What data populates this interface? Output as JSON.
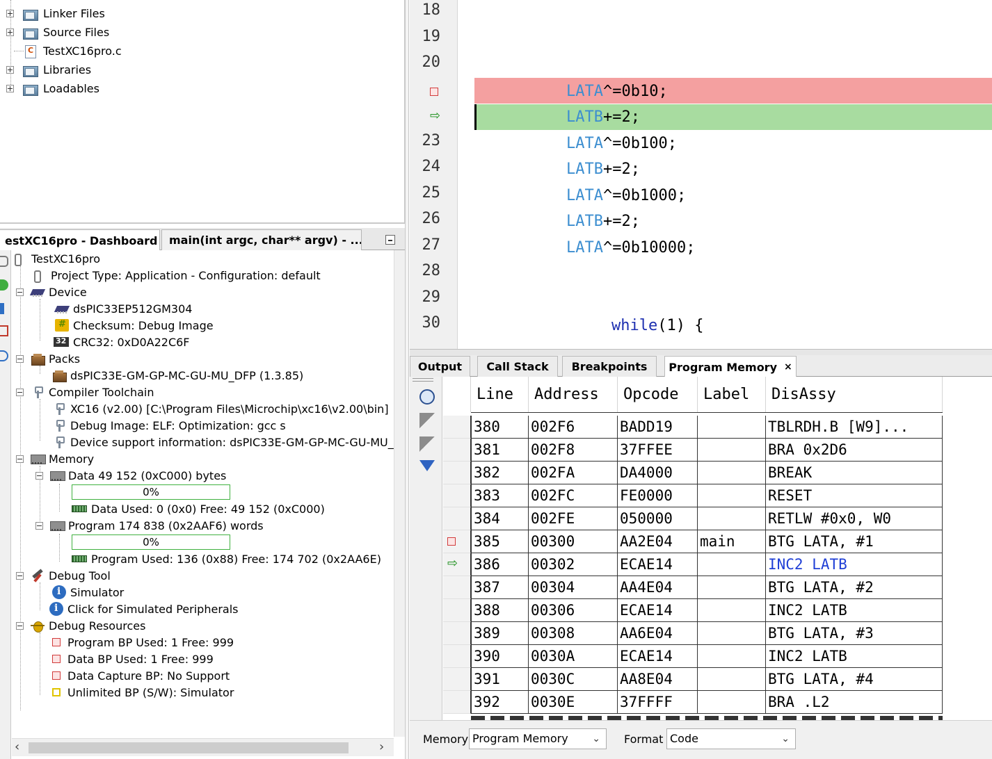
{
  "projects_tree": {
    "items": [
      {
        "label": "Linker Files",
        "expander": "plus",
        "icon": "folder-icon"
      },
      {
        "label": "Source Files",
        "expander": "plus",
        "icon": "folder-icon"
      },
      {
        "label": "TestXC16pro.c",
        "expander": "none",
        "icon": "c-file-icon"
      },
      {
        "label": "Libraries",
        "expander": "plus",
        "icon": "folder-icon"
      },
      {
        "label": "Loadables",
        "expander": "plus",
        "icon": "folder-icon"
      }
    ]
  },
  "dashboard": {
    "tabs": [
      {
        "label": "estXC16pro - Dashboard",
        "close": "×",
        "active": true
      },
      {
        "label": "main(int argc, char** argv) - ...",
        "active": false
      }
    ],
    "tree": {
      "root": "TestXC16pro",
      "project_type": "Project Type: Application - Configuration: default",
      "device": "Device",
      "device_name": "dsPIC33EP512GM304",
      "checksum": "Checksum: Debug Image",
      "crc": "CRC32: 0xD0A22C6F",
      "packs": "Packs",
      "pack_name": "dsPIC33E-GM-GP-MC-GU-MU_DFP (1.3.85)",
      "toolchain": "Compiler Toolchain",
      "toolchain_xc16": "XC16 (v2.00) [C:\\Program Files\\Microchip\\xc16\\v2.00\\bin]",
      "toolchain_debug": "Debug Image: ELF: Optimization: gcc s",
      "toolchain_support": "Device support information: dsPIC33E-GM-GP-MC-GU-MU_DFP",
      "memory": "Memory",
      "data_mem": "Data 49 152 (0xC000) bytes",
      "data_pct": "0%",
      "data_pct_value": 0,
      "data_used": "Data Used: 0 (0x0) Free: 49 152 (0xC000)",
      "prog_mem": "Program 174 838 (0x2AAF6) words",
      "prog_pct": "0%",
      "prog_pct_value": 0,
      "prog_used": "Program Used: 136 (0x88) Free: 174 702 (0x2AA6E)",
      "debug_tool": "Debug Tool",
      "simulator": "Simulator",
      "sim_periph": "Click for Simulated Peripherals",
      "debug_res": "Debug Resources",
      "prog_bp": "Program BP Used: 1  Free: 999",
      "data_bp": "Data BP Used: 1  Free: 999",
      "data_cap": "Data Capture BP: No Support",
      "unlim_bp": "Unlimited BP (S/W): Simulator"
    }
  },
  "editor": {
    "lines": [
      {
        "num": "18",
        "code": ""
      },
      {
        "num": "19",
        "code": ""
      },
      {
        "num": "20",
        "code": ""
      },
      {
        "num": "",
        "marker": "breakpoint",
        "code_kw": "LATA",
        "code_rest": "^=0b10;"
      },
      {
        "num": "",
        "marker": "pc",
        "code_kw": "LATB",
        "code_rest": "+=2;"
      },
      {
        "num": "23",
        "code_kw": "LATA",
        "code_rest": "^=0b100;"
      },
      {
        "num": "24",
        "code_kw": "LATB",
        "code_rest": "+=2;"
      },
      {
        "num": "25",
        "code_kw": "LATA",
        "code_rest": "^=0b1000;"
      },
      {
        "num": "26",
        "code_kw": "LATB",
        "code_rest": "+=2;"
      },
      {
        "num": "27",
        "code_kw": "LATA",
        "code_rest": "^=0b10000;"
      },
      {
        "num": "28",
        "code": ""
      },
      {
        "num": "29",
        "code": ""
      },
      {
        "num": "30",
        "code_kw2": "while",
        "code_rest": "(1) {"
      }
    ],
    "colors": {
      "breakpoint_bg": "#f4a0a0",
      "pc_bg": "#a8dca0",
      "keyword": "#3c8ed0",
      "while": "#1d2fb0"
    }
  },
  "output_tabs": [
    {
      "label": "Output"
    },
    {
      "label": "Call Stack"
    },
    {
      "label": "Breakpoints"
    },
    {
      "label": "Program Memory",
      "close": "×",
      "active": true
    }
  ],
  "program_memory": {
    "columns": [
      "Line",
      "Address",
      "Opcode",
      "Label",
      "DisAssy"
    ],
    "rows": [
      {
        "line": "380",
        "address": "002F6",
        "opcode": "BADD19",
        "label": "",
        "disassy": "TBLRDH.B [W9]..."
      },
      {
        "line": "381",
        "address": "002F8",
        "opcode": "37FFEE",
        "label": "",
        "disassy": "BRA 0x2D6"
      },
      {
        "line": "382",
        "address": "002FA",
        "opcode": "DA4000",
        "label": "",
        "disassy": "BREAK"
      },
      {
        "line": "383",
        "address": "002FC",
        "opcode": "FE0000",
        "label": "",
        "disassy": "RESET"
      },
      {
        "line": "384",
        "address": "002FE",
        "opcode": "050000",
        "label": "",
        "disassy": "RETLW #0x0, W0"
      },
      {
        "line": "385",
        "address": "00300",
        "opcode": "AA2E04",
        "label": "main",
        "disassy": "BTG LATA, #1",
        "marker": "breakpoint"
      },
      {
        "line": "386",
        "address": "00302",
        "opcode": "ECAE14",
        "label": "",
        "disassy": "INC2 LATB",
        "marker": "pc"
      },
      {
        "line": "387",
        "address": "00304",
        "opcode": "AA4E04",
        "label": "",
        "disassy": "BTG LATA, #2"
      },
      {
        "line": "388",
        "address": "00306",
        "opcode": "ECAE14",
        "label": "",
        "disassy": "INC2 LATB"
      },
      {
        "line": "389",
        "address": "00308",
        "opcode": "AA6E04",
        "label": "",
        "disassy": "BTG LATA, #3"
      },
      {
        "line": "390",
        "address": "0030A",
        "opcode": "ECAE14",
        "label": "",
        "disassy": "INC2 LATB"
      },
      {
        "line": "391",
        "address": "0030C",
        "opcode": "AA8E04",
        "label": "",
        "disassy": "BTG LATA, #4"
      },
      {
        "line": "392",
        "address": "0030E",
        "opcode": "37FFFF",
        "label": "",
        "disassy": "BRA .L2"
      }
    ],
    "memory_label": "Memory",
    "memory_value": "Program Memory",
    "format_label": "Format",
    "format_value": "Code"
  }
}
